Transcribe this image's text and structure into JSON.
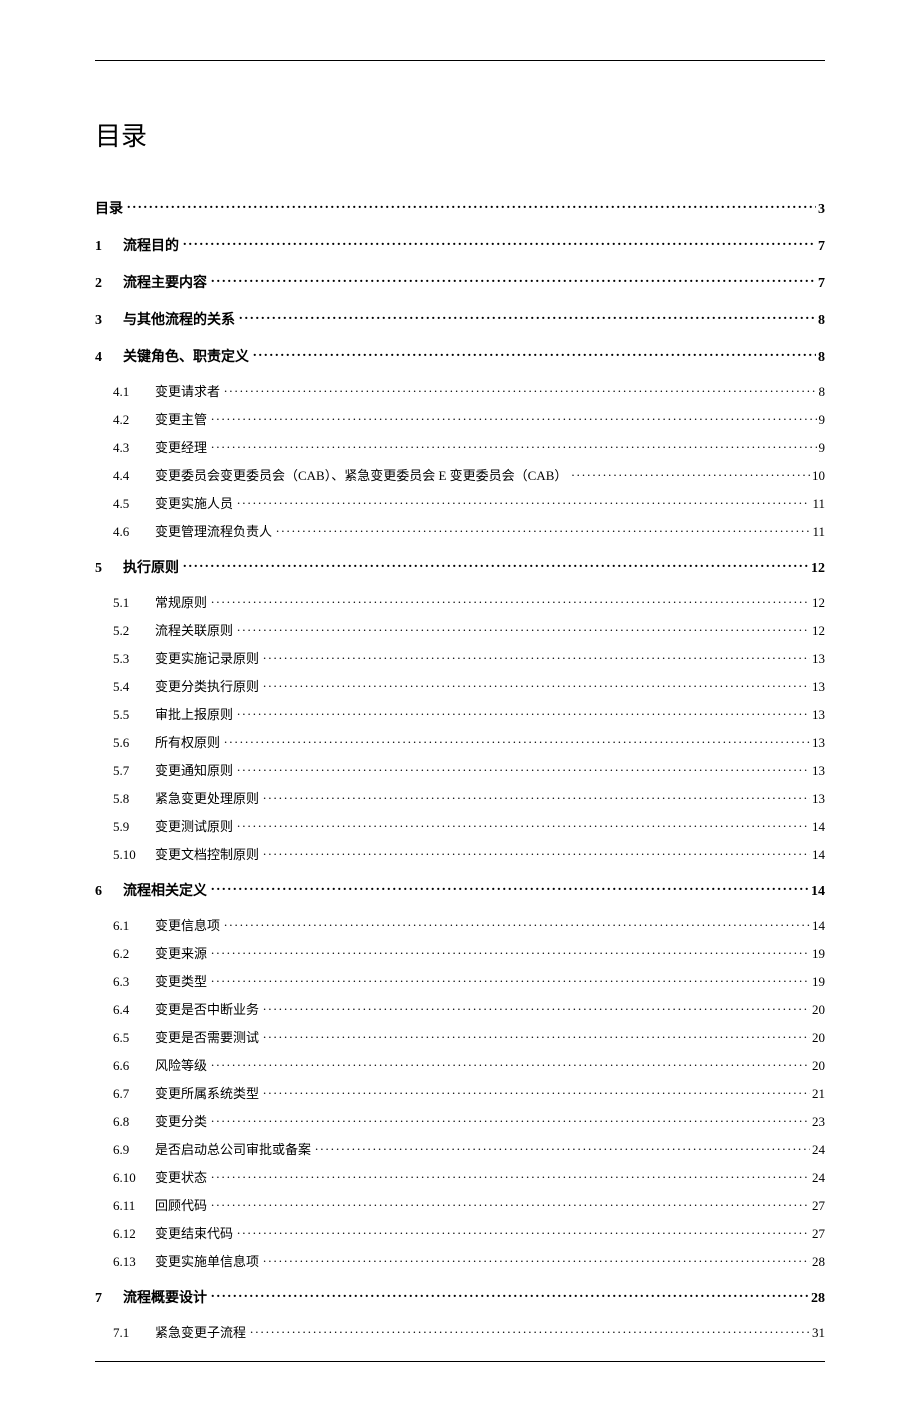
{
  "page_title": "目录",
  "toc": [
    {
      "level": 0,
      "num": "",
      "title": "目录",
      "page": "3"
    },
    {
      "level": 1,
      "num": "1",
      "title": "流程目的",
      "page": "7"
    },
    {
      "level": 1,
      "num": "2",
      "title": "流程主要内容",
      "page": "7"
    },
    {
      "level": 1,
      "num": "3",
      "title": "与其他流程的关系",
      "page": "8"
    },
    {
      "level": 1,
      "num": "4",
      "title": "关键角色、职责定义",
      "page": "8"
    },
    {
      "level": 2,
      "num": "4.1",
      "title": "变更请求者",
      "page": "8",
      "first": true
    },
    {
      "level": 2,
      "num": "4.2",
      "title": "变更主管",
      "page": "9"
    },
    {
      "level": 2,
      "num": "4.3",
      "title": "变更经理",
      "page": "9"
    },
    {
      "level": 2,
      "num": "4.4",
      "title": "变更委员会变更委员会（CAB）、紧急变更委员会 E 变更委员会（CAB）",
      "page": "10"
    },
    {
      "level": 2,
      "num": "4.5",
      "title": "变更实施人员",
      "page": "11"
    },
    {
      "level": 2,
      "num": "4.6",
      "title": "变更管理流程负责人",
      "page": "11"
    },
    {
      "level": 1,
      "num": "5",
      "title": "执行原则",
      "page": "12"
    },
    {
      "level": 2,
      "num": "5.1",
      "title": "常规原则",
      "page": "12",
      "first": true
    },
    {
      "level": 2,
      "num": "5.2",
      "title": "流程关联原则",
      "page": "12"
    },
    {
      "level": 2,
      "num": "5.3",
      "title": "变更实施记录原则",
      "page": "13"
    },
    {
      "level": 2,
      "num": "5.4",
      "title": "变更分类执行原则",
      "page": "13"
    },
    {
      "level": 2,
      "num": "5.5",
      "title": "审批上报原则",
      "page": "13"
    },
    {
      "level": 2,
      "num": "5.6",
      "title": "所有权原则",
      "page": "13"
    },
    {
      "level": 2,
      "num": "5.7",
      "title": "变更通知原则",
      "page": "13"
    },
    {
      "level": 2,
      "num": "5.8",
      "title": "紧急变更处理原则",
      "page": "13"
    },
    {
      "level": 2,
      "num": "5.9",
      "title": "变更测试原则",
      "page": "14"
    },
    {
      "level": 2,
      "num": "5.10",
      "title": "变更文档控制原则",
      "page": "14"
    },
    {
      "level": 1,
      "num": "6",
      "title": "流程相关定义",
      "page": "14"
    },
    {
      "level": 2,
      "num": "6.1",
      "title": "变更信息项",
      "page": "14",
      "first": true
    },
    {
      "level": 2,
      "num": "6.2",
      "title": "变更来源",
      "page": "19"
    },
    {
      "level": 2,
      "num": "6.3",
      "title": "变更类型",
      "page": "19"
    },
    {
      "level": 2,
      "num": "6.4",
      "title": "变更是否中断业务",
      "page": "20"
    },
    {
      "level": 2,
      "num": "6.5",
      "title": "变更是否需要测试",
      "page": "20"
    },
    {
      "level": 2,
      "num": "6.6",
      "title": "风险等级",
      "page": "20"
    },
    {
      "level": 2,
      "num": "6.7",
      "title": "变更所属系统类型",
      "page": "21"
    },
    {
      "level": 2,
      "num": "6.8",
      "title": "变更分类",
      "page": "23"
    },
    {
      "level": 2,
      "num": "6.9",
      "title": "是否启动总公司审批或备案",
      "page": "24"
    },
    {
      "level": 2,
      "num": "6.10",
      "title": "变更状态",
      "page": "24"
    },
    {
      "level": 2,
      "num": "6.11",
      "title": "回顾代码",
      "page": "27"
    },
    {
      "level": 2,
      "num": "6.12",
      "title": "变更结束代码",
      "page": "27"
    },
    {
      "level": 2,
      "num": "6.13",
      "title": "变更实施单信息项",
      "page": "28"
    },
    {
      "level": 1,
      "num": "7",
      "title": "流程概要设计",
      "page": "28"
    },
    {
      "level": 2,
      "num": "7.1",
      "title": "紧急变更子流程",
      "page": "31",
      "first": true
    }
  ]
}
